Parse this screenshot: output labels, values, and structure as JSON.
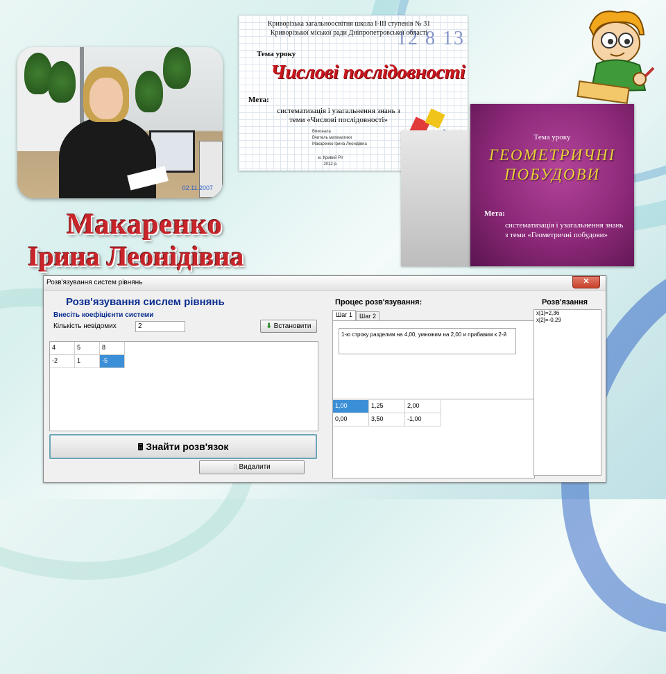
{
  "presenter": {
    "surname": "Макаренко",
    "given_names": "Ірина Леонідівна",
    "photo_stamp": "02.11.2007"
  },
  "slide1": {
    "school_line1": "Криворізька загальноосвітня школа І-ІІІ ступенів № 31",
    "school_line2": "Криворізької міської ради Дніпропетровської області",
    "decor_numbers": "12 8 13",
    "topic_label": "Тема уроку",
    "title": "Числові послідовності",
    "goal_label": "Мета:",
    "goal_text": "систематизація і узагальнення знань з теми «Числові послідовності»",
    "author_line1": "Виконала",
    "author_line2": "Вчитель математики",
    "author_line3": "Макаренко Ірина Леонідівна",
    "city": "м. Кривий Ріг",
    "year": "2012 р."
  },
  "slide2": {
    "topic_label": "Тема уроку",
    "title_line1": "ГЕОМЕТРИЧНІ",
    "title_line2": "ПОБУДОВИ",
    "goal_label": "Мета:",
    "goal_text": "систематизація і узагальнення знань з теми «Геометричні побудови»"
  },
  "window": {
    "title": "Розв'язування систем рівнянь",
    "close_label": "✕",
    "heading": "Розв'язування сислем рівнянь",
    "subheading": "Внесіть коефіцієнти системи",
    "unknowns_label": "Кількість невідомих",
    "unknowns_value": "2",
    "set_button": "Встановити",
    "coef_rows": [
      [
        "4",
        "5",
        "8"
      ],
      [
        "-2",
        "1",
        "-5"
      ]
    ],
    "find_button": "Знайти розв'язок",
    "delete_button": "Видалити",
    "process_heading": "Процес розв'язування:",
    "tabs": [
      "Шаг 1",
      "Шаг 2"
    ],
    "step_message": "1-ю строку разделим на 4,00, умножим на 2,00 и прибавим к 2-й",
    "step_rows": [
      [
        "1,00",
        "1,25",
        "2,00"
      ],
      [
        "0,00",
        "3,50",
        "-1,00"
      ]
    ],
    "result_heading": "Розв'язання",
    "results": [
      "x[1]=2,36",
      "x[2]=-0,29"
    ]
  },
  "colors": {
    "accent_red": "#c8252b",
    "heading_blue": "#0b2d8f",
    "selection_blue": "#3b8fd6",
    "slide2_purple": "#8b2877",
    "slide2_title_gold": "#e8d23a"
  }
}
